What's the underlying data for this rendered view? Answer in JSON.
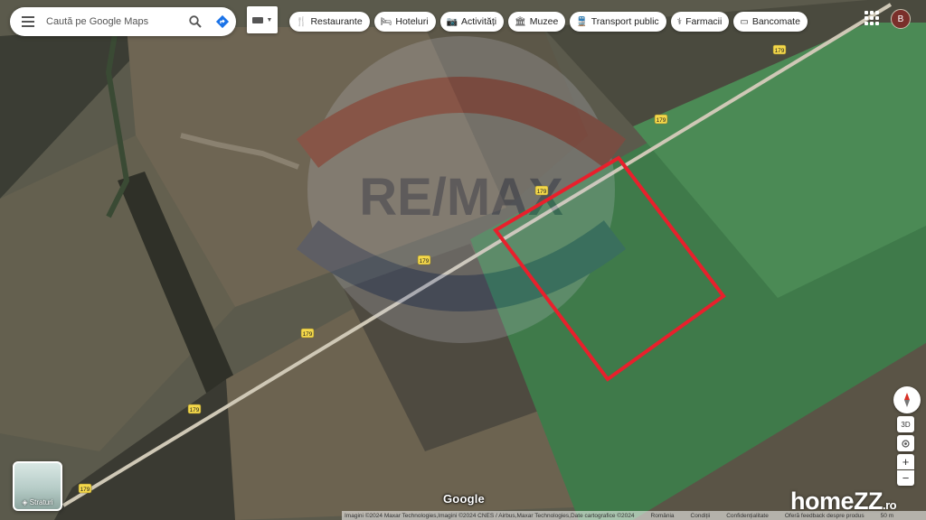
{
  "search": {
    "placeholder": "Caută pe Google Maps"
  },
  "chips": [
    {
      "label": "Restaurante",
      "icon": "fork-knife-icon",
      "glyph": "🍴"
    },
    {
      "label": "Hoteluri",
      "icon": "bed-icon",
      "glyph": "🛏"
    },
    {
      "label": "Activități",
      "icon": "camera-icon",
      "glyph": "📷"
    },
    {
      "label": "Muzee",
      "icon": "museum-icon",
      "glyph": "🏛"
    },
    {
      "label": "Transport public",
      "icon": "train-icon",
      "glyph": "🚆"
    },
    {
      "label": "Farmacii",
      "icon": "pharmacy-icon",
      "glyph": "⚕"
    },
    {
      "label": "Bancomate",
      "icon": "atm-icon",
      "glyph": "▭"
    }
  ],
  "account": {
    "initial": "B"
  },
  "layers": {
    "label": "Straturi"
  },
  "controls": {
    "threed": "3D",
    "zoom_in": "+",
    "zoom_out": "−"
  },
  "road": {
    "number": "179"
  },
  "watermark": {
    "text": "RE/MAX"
  },
  "logo": {
    "text": "Google"
  },
  "attribution": {
    "imagery": "Imagini ©2024 Maxar Technologies,Imagini ©2024 CNES / Airbus,Maxar Technologies,Date cartografice ©2024",
    "country": "România",
    "terms": "Condiții",
    "privacy": "Confidențialitate",
    "feedback": "Oferă feedback despre produs",
    "scale": "50 m"
  },
  "brand": {
    "name": "homeZZ",
    "tld": ".ro"
  },
  "colors": {
    "parcel_outline": "#e8202c",
    "field_green": "#3f7a4a",
    "road": "#cfc8b6"
  }
}
